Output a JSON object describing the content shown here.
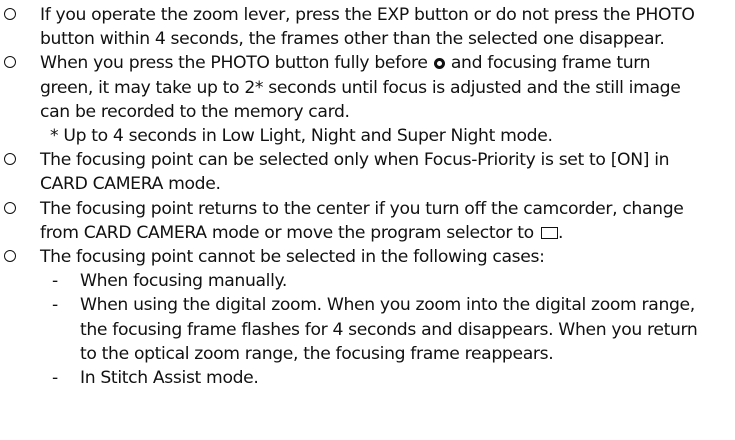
{
  "notes": [
    {
      "lines": [
        "If you operate the zoom lever, press the EXP button or do not press the PHOTO",
        "button within 4 seconds, the frames other than the selected one disappear."
      ]
    },
    {
      "line1_before_icon": "When you press the PHOTO button fully before",
      "line1_after_icon": "and focusing frame turn",
      "lines_rest": [
        "green, it may take up to 2* seconds until focus is adjusted and the still image",
        "can be recorded to the memory card."
      ],
      "footnote": "* Up to 4 seconds in Low Light, Night and Super Night mode.",
      "icon": "focus-indicator-icon"
    },
    {
      "lines": [
        "The focusing point can be selected only when Focus-Priority is set to [ON] in",
        "CARD CAMERA mode."
      ]
    },
    {
      "line1": "The focusing point returns to the center if you turn off the camcorder, change",
      "line2_before_icon": "from CARD CAMERA mode or move the program selector to",
      "line2_after_icon": ".",
      "icon": "program-auto-icon"
    },
    {
      "lines": [
        "The focusing point cannot be selected in the following cases:"
      ],
      "cases": [
        {
          "dash": "-",
          "lines": [
            "When focusing manually."
          ]
        },
        {
          "dash": "-",
          "lines": [
            "When using the digital zoom. When you zoom into the digital zoom range,",
            "the focusing frame flashes for 4 seconds and disappears. When you return",
            "to the optical zoom range, the focusing frame reappears."
          ]
        },
        {
          "dash": "-",
          "lines": [
            "In Stitch Assist mode."
          ]
        }
      ]
    }
  ],
  "bullet_icon": "circle-bullet-icon"
}
